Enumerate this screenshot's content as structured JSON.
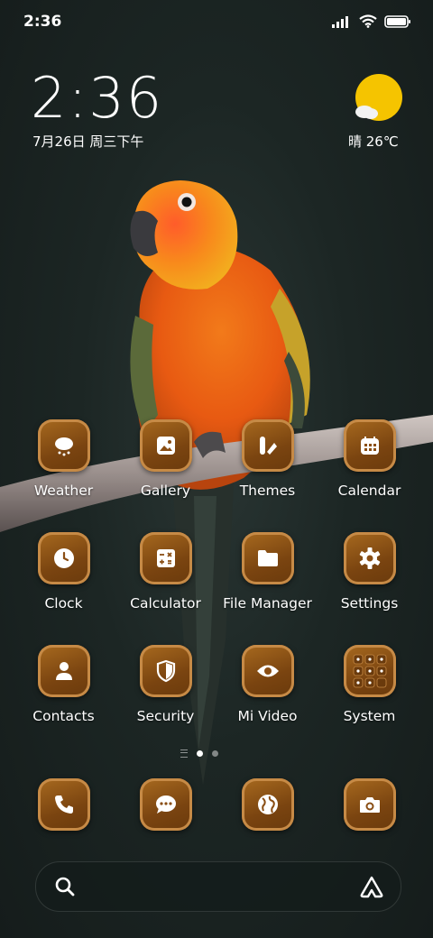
{
  "status_bar": {
    "time": "2:36"
  },
  "lock_clock": {
    "time": "2:36",
    "date": "7月26日 周三下午"
  },
  "weather": {
    "text": "晴 26℃",
    "icon": "sun-cloud-icon"
  },
  "apps_row1": [
    {
      "label": "Weather",
      "icon": "weather-icon"
    },
    {
      "label": "Gallery",
      "icon": "gallery-icon"
    },
    {
      "label": "Themes",
      "icon": "themes-icon"
    },
    {
      "label": "Calendar",
      "icon": "calendar-icon"
    }
  ],
  "apps_row2": [
    {
      "label": "Clock",
      "icon": "clock-icon"
    },
    {
      "label": "Calculator",
      "icon": "calculator-icon"
    },
    {
      "label": "File Manager",
      "icon": "folder-icon"
    },
    {
      "label": "Settings",
      "icon": "gear-icon"
    }
  ],
  "apps_row3": [
    {
      "label": "Contacts",
      "icon": "person-icon"
    },
    {
      "label": "Security",
      "icon": "shield-icon"
    },
    {
      "label": "Mi Video",
      "icon": "eye-icon"
    },
    {
      "label": "System",
      "icon": "folder-grid-icon"
    }
  ],
  "dock": [
    {
      "icon": "phone-icon"
    },
    {
      "icon": "message-icon"
    },
    {
      "icon": "browser-globe-icon"
    },
    {
      "icon": "camera-icon"
    }
  ],
  "colors": {
    "icon_bg": "#7a4410",
    "icon_border": "#c68a46",
    "sun": "#f5c400"
  }
}
